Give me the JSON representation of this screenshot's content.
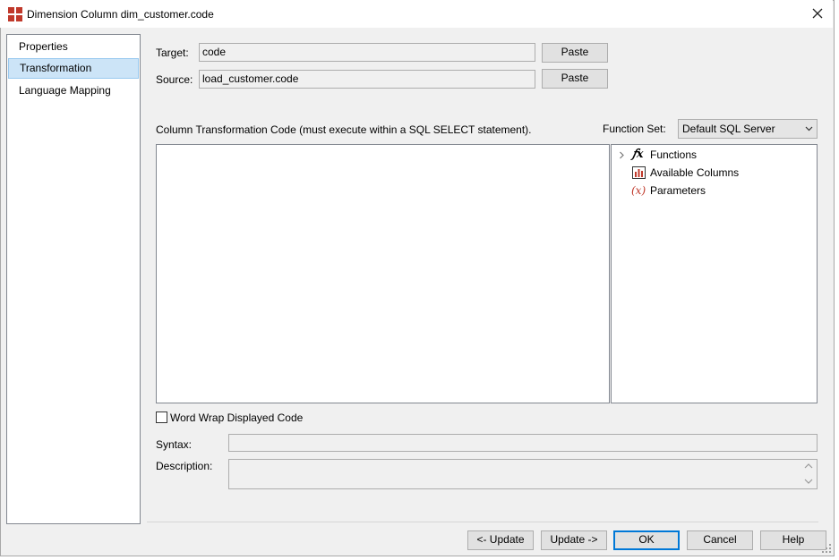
{
  "window": {
    "title": "Dimension Column dim_customer.code"
  },
  "nav": {
    "items": [
      {
        "label": "Properties",
        "selected": false
      },
      {
        "label": "Transformation",
        "selected": true
      },
      {
        "label": "Language Mapping",
        "selected": false
      }
    ]
  },
  "form": {
    "target_label": "Target:",
    "target_value": "code",
    "source_label": "Source:",
    "source_value": "load_customer.code",
    "paste_label": "Paste",
    "code_caption": "Column Transformation Code (must execute within a SQL SELECT statement).",
    "function_set_label": "Function Set:",
    "function_set_value": "Default SQL Server",
    "code_value": "",
    "word_wrap_label": "Word Wrap Displayed Code",
    "word_wrap_checked": false,
    "syntax_label": "Syntax:",
    "syntax_value": "",
    "description_label": "Description:",
    "description_value": ""
  },
  "tree": {
    "items": [
      {
        "label": "Functions",
        "icon": "function-fx-icon"
      },
      {
        "label": "Available Columns",
        "icon": "columns-chart-icon"
      },
      {
        "label": "Parameters",
        "icon": "parameter-x-icon"
      }
    ]
  },
  "footer": {
    "update_prev": "<- Update",
    "update_next": "Update ->",
    "ok": "OK",
    "cancel": "Cancel",
    "help": "Help"
  },
  "colors": {
    "selection_bg": "#cce4f7",
    "selection_border": "#99c9ef",
    "default_button_border": "#0078d7",
    "icon_red": "#c0392b"
  }
}
